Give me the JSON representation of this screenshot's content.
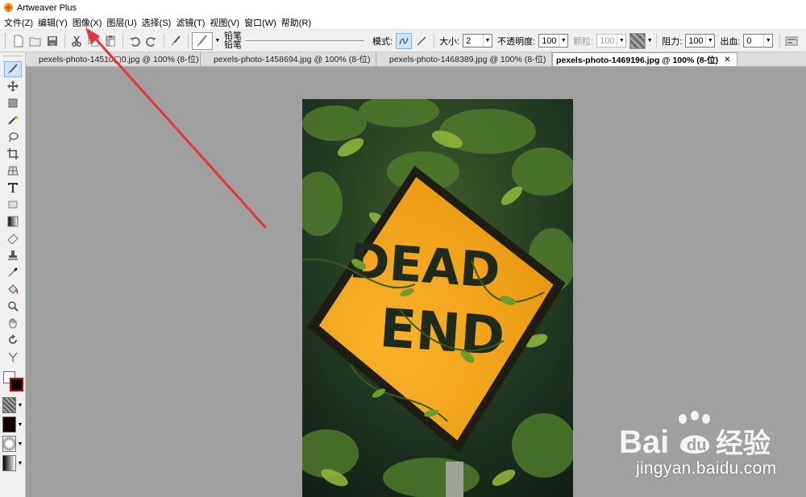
{
  "app": {
    "title": "Artweaver Plus"
  },
  "menu": [
    {
      "label": "文件(Z)"
    },
    {
      "label": "编辑(Y)"
    },
    {
      "label": "图像(X)"
    },
    {
      "label": "图层(U)"
    },
    {
      "label": "选择(S)"
    },
    {
      "label": "滤镜(T)"
    },
    {
      "label": "视图(V)"
    },
    {
      "label": "窗口(W)"
    },
    {
      "label": "帮助(R)"
    }
  ],
  "toolbar": {
    "brush_category": "铅笔",
    "brush_name": "铅笔",
    "mode_label": "模式:",
    "size_label": "大小:",
    "size_value": "2",
    "opacity_label": "不透明度:",
    "opacity_value": "100",
    "grain_label": "颗粒:",
    "grain_value": "100",
    "resistance_label": "阻力:",
    "resistance_value": "100",
    "bleed_label": "出血:",
    "bleed_value": "0"
  },
  "tabs": [
    {
      "label": "pexels-photo-14510▢0.jpg @ 100% (8-位)",
      "active": false
    },
    {
      "label": "pexels-photo-1458694.jpg @ 100% (8-位)",
      "active": false
    },
    {
      "label": "pexels-photo-1468389.jpg @ 100% (8-位)",
      "active": false
    },
    {
      "label": "pexels-photo-1469196.jpg @ 100% (8-位)",
      "active": true
    }
  ],
  "sign": {
    "line1": "DEAD",
    "line2": "END",
    "color": "#f5a41a"
  },
  "colors": {
    "foreground": "#ffffff",
    "background": "#000000",
    "arrow": "#e8333a"
  },
  "watermark": {
    "brand_left": "Bai",
    "brand_right": "经验",
    "url": "jingyan.baidu.com"
  }
}
